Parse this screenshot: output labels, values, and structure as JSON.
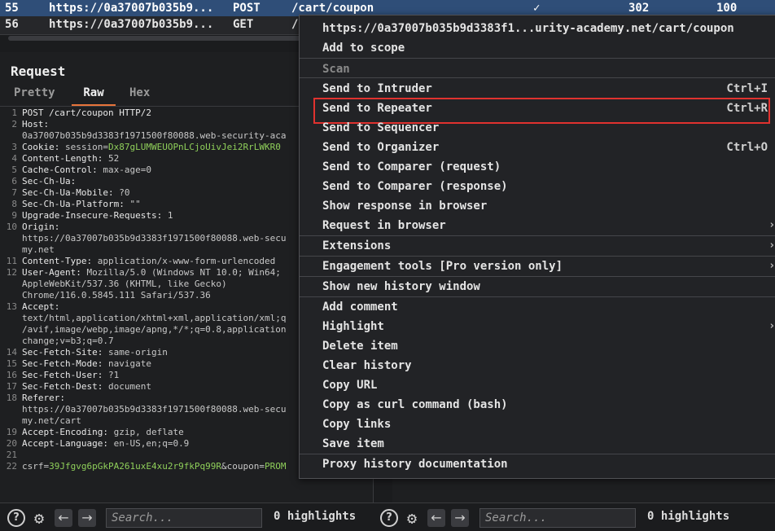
{
  "history": {
    "rows": [
      {
        "id": "55",
        "url": "https://0a37007b035b9...",
        "method": "POST",
        "path": "/cart/coupon",
        "check": "✓",
        "status": "302",
        "length": "100"
      },
      {
        "id": "56",
        "url": "https://0a37007b035b9...",
        "method": "GET",
        "path": "/",
        "check": "",
        "status": "",
        "length": ""
      }
    ]
  },
  "request": {
    "title": "Request",
    "tabs": [
      "Pretty",
      "Raw",
      "Hex"
    ],
    "active_tab": "Raw",
    "lines": [
      {
        "n": "1",
        "parts": [
          {
            "t": "POST /cart/coupon HTTP/2",
            "c": "k"
          }
        ]
      },
      {
        "n": "2",
        "parts": [
          {
            "t": "Host:",
            "c": "k"
          }
        ]
      },
      {
        "n": "",
        "parts": [
          {
            "t": "0a37007b035b9d3383f1971500f80088.web-security-aca",
            "c": "v"
          }
        ]
      },
      {
        "n": "3",
        "parts": [
          {
            "t": "Cookie: ",
            "c": "k"
          },
          {
            "t": "session=",
            "c": "v"
          },
          {
            "t": "Dx87gLUMWEUOPnLCjoUivJei2RrLWKR0",
            "c": "g"
          }
        ]
      },
      {
        "n": "4",
        "parts": [
          {
            "t": "Content-Length: ",
            "c": "k"
          },
          {
            "t": "52",
            "c": "v"
          }
        ]
      },
      {
        "n": "5",
        "parts": [
          {
            "t": "Cache-Control: ",
            "c": "k"
          },
          {
            "t": "max-age=0",
            "c": "v"
          }
        ]
      },
      {
        "n": "6",
        "parts": [
          {
            "t": "Sec-Ch-Ua:",
            "c": "k"
          }
        ]
      },
      {
        "n": "7",
        "parts": [
          {
            "t": "Sec-Ch-Ua-Mobile: ",
            "c": "k"
          },
          {
            "t": "?0",
            "c": "v"
          }
        ]
      },
      {
        "n": "8",
        "parts": [
          {
            "t": "Sec-Ch-Ua-Platform: ",
            "c": "k"
          },
          {
            "t": "\"\"",
            "c": "v"
          }
        ]
      },
      {
        "n": "9",
        "parts": [
          {
            "t": "Upgrade-Insecure-Requests: ",
            "c": "k"
          },
          {
            "t": "1",
            "c": "v"
          }
        ]
      },
      {
        "n": "10",
        "parts": [
          {
            "t": "Origin:",
            "c": "k"
          }
        ]
      },
      {
        "n": "",
        "parts": [
          {
            "t": "https://0a37007b035b9d3383f1971500f80088.web-secu",
            "c": "v"
          }
        ]
      },
      {
        "n": "",
        "parts": [
          {
            "t": "my.net",
            "c": "v"
          }
        ]
      },
      {
        "n": "11",
        "parts": [
          {
            "t": "Content-Type: ",
            "c": "k"
          },
          {
            "t": "application/x-www-form-urlencoded",
            "c": "v"
          }
        ]
      },
      {
        "n": "12",
        "parts": [
          {
            "t": "User-Agent: ",
            "c": "k"
          },
          {
            "t": "Mozilla/5.0 (Windows NT 10.0; Win64;",
            "c": "v"
          }
        ]
      },
      {
        "n": "",
        "parts": [
          {
            "t": "AppleWebKit/537.36 (KHTML, like Gecko)",
            "c": "v"
          }
        ]
      },
      {
        "n": "",
        "parts": [
          {
            "t": "Chrome/116.0.5845.111 Safari/537.36",
            "c": "v"
          }
        ]
      },
      {
        "n": "13",
        "parts": [
          {
            "t": "Accept:",
            "c": "k"
          }
        ]
      },
      {
        "n": "",
        "parts": [
          {
            "t": "text/html,application/xhtml+xml,application/xml;q",
            "c": "v"
          }
        ]
      },
      {
        "n": "",
        "parts": [
          {
            "t": "/avif,image/webp,image/apng,*/*;q=0.8,application",
            "c": "v"
          }
        ]
      },
      {
        "n": "",
        "parts": [
          {
            "t": "change;v=b3;q=0.7",
            "c": "v"
          }
        ]
      },
      {
        "n": "14",
        "parts": [
          {
            "t": "Sec-Fetch-Site: ",
            "c": "k"
          },
          {
            "t": "same-origin",
            "c": "v"
          }
        ]
      },
      {
        "n": "15",
        "parts": [
          {
            "t": "Sec-Fetch-Mode: ",
            "c": "k"
          },
          {
            "t": "navigate",
            "c": "v"
          }
        ]
      },
      {
        "n": "16",
        "parts": [
          {
            "t": "Sec-Fetch-User: ",
            "c": "k"
          },
          {
            "t": "?1",
            "c": "v"
          }
        ]
      },
      {
        "n": "17",
        "parts": [
          {
            "t": "Sec-Fetch-Dest: ",
            "c": "k"
          },
          {
            "t": "document",
            "c": "v"
          }
        ]
      },
      {
        "n": "18",
        "parts": [
          {
            "t": "Referer:",
            "c": "k"
          }
        ]
      },
      {
        "n": "",
        "parts": [
          {
            "t": "https://0a37007b035b9d3383f1971500f80088.web-secu",
            "c": "v"
          }
        ]
      },
      {
        "n": "",
        "parts": [
          {
            "t": "my.net/cart",
            "c": "v"
          }
        ]
      },
      {
        "n": "19",
        "parts": [
          {
            "t": "Accept-Encoding: ",
            "c": "k"
          },
          {
            "t": "gzip, deflate",
            "c": "v"
          }
        ]
      },
      {
        "n": "20",
        "parts": [
          {
            "t": "Accept-Language: ",
            "c": "k"
          },
          {
            "t": "en-US,en;q=0.9",
            "c": "v"
          }
        ]
      },
      {
        "n": "21",
        "parts": [
          {
            "t": "",
            "c": "v"
          }
        ]
      },
      {
        "n": "22",
        "parts": [
          {
            "t": "csrf=",
            "c": "v"
          },
          {
            "t": "39Jfgvg6pGkPA261uxE4xu2r9fkPq99R",
            "c": "g"
          },
          {
            "t": "&coupon=",
            "c": "v"
          },
          {
            "t": "PROM",
            "c": "g"
          }
        ]
      }
    ]
  },
  "bottombar": {
    "search_placeholder": "Search...",
    "highlights": "0 highlights"
  },
  "context_menu": {
    "items": [
      {
        "label": "https://0a37007b035b9d3383f1...urity-academy.net/cart/coupon",
        "shortcut": "",
        "submenu": false,
        "disabled": false
      },
      {
        "label": "Add to scope",
        "shortcut": "",
        "submenu": false,
        "disabled": false,
        "sep_after": true
      },
      {
        "label": "Scan",
        "shortcut": "",
        "submenu": false,
        "disabled": true,
        "sep_after": true
      },
      {
        "label": "Send to Intruder",
        "shortcut": "Ctrl+I",
        "submenu": false,
        "disabled": false
      },
      {
        "label": "Send to Repeater",
        "shortcut": "Ctrl+R",
        "submenu": false,
        "disabled": false,
        "highlighted": true
      },
      {
        "label": "Send to Sequencer",
        "shortcut": "",
        "submenu": false,
        "disabled": false
      },
      {
        "label": "Send to Organizer",
        "shortcut": "Ctrl+O",
        "submenu": false,
        "disabled": false
      },
      {
        "label": "Send to Comparer (request)",
        "shortcut": "",
        "submenu": false,
        "disabled": false
      },
      {
        "label": "Send to Comparer (response)",
        "shortcut": "",
        "submenu": false,
        "disabled": false
      },
      {
        "label": "Show response in browser",
        "shortcut": "",
        "submenu": false,
        "disabled": false
      },
      {
        "label": "Request in browser",
        "shortcut": "",
        "submenu": true,
        "disabled": false,
        "sep_after": true
      },
      {
        "label": "Extensions",
        "shortcut": "",
        "submenu": true,
        "disabled": false,
        "sep_after": true
      },
      {
        "label": "Engagement tools [Pro version only]",
        "shortcut": "",
        "submenu": true,
        "disabled": false,
        "sep_after": true
      },
      {
        "label": "Show new history window",
        "shortcut": "",
        "submenu": false,
        "disabled": false,
        "sep_after": true
      },
      {
        "label": "Add comment",
        "shortcut": "",
        "submenu": false,
        "disabled": false
      },
      {
        "label": "Highlight",
        "shortcut": "",
        "submenu": true,
        "disabled": false
      },
      {
        "label": "Delete item",
        "shortcut": "",
        "submenu": false,
        "disabled": false
      },
      {
        "label": "Clear history",
        "shortcut": "",
        "submenu": false,
        "disabled": false
      },
      {
        "label": "Copy URL",
        "shortcut": "",
        "submenu": false,
        "disabled": false
      },
      {
        "label": "Copy as curl command (bash)",
        "shortcut": "",
        "submenu": false,
        "disabled": false
      },
      {
        "label": "Copy links",
        "shortcut": "",
        "submenu": false,
        "disabled": false
      },
      {
        "label": "Save item",
        "shortcut": "",
        "submenu": false,
        "disabled": false,
        "sep_after": true
      },
      {
        "label": "Proxy history documentation",
        "shortcut": "",
        "submenu": false,
        "disabled": false
      }
    ]
  },
  "colors": {
    "selected_row": "#2f4e78",
    "active_tab_underline": "#e8743b",
    "highlight_box": "#e0322f",
    "param_value": "#8fcf5a"
  },
  "icons": [
    "help-icon",
    "settings-gear-icon",
    "back-arrow-icon",
    "forward-arrow-icon",
    "submenu-chevron-icon",
    "checkmark-icon"
  ]
}
